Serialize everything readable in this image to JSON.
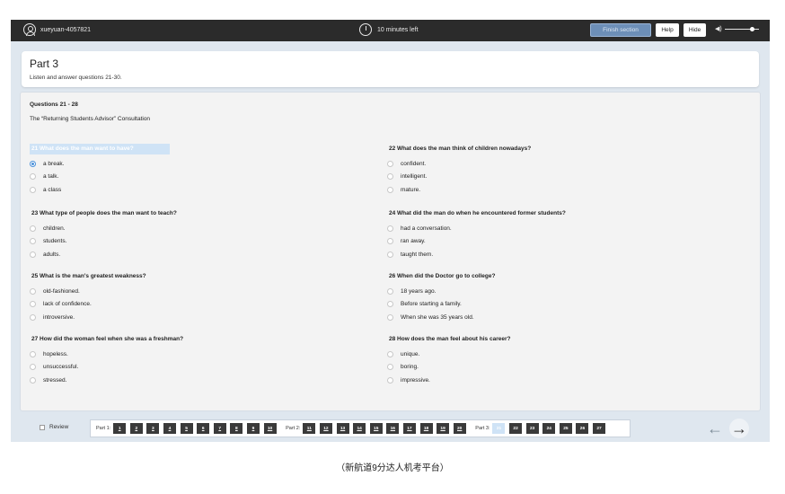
{
  "topbar": {
    "username": "xueyuan-4057821",
    "timer": "10 minutes left",
    "finish_label": "Finish section",
    "help_label": "Help",
    "hide_label": "Hide"
  },
  "part": {
    "title": "Part 3",
    "instruction": "Listen and answer questions 21-30."
  },
  "section": {
    "range": "Questions 21 - 28",
    "topic": "The “Returning Students Advisor” Consultation"
  },
  "questions": {
    "q21": {
      "text": "21 What does the man want to have?",
      "options": [
        "a break.",
        "a talk.",
        "a class"
      ]
    },
    "q22": {
      "text": "22 What does the man think of children nowadays?",
      "options": [
        "confident.",
        "intelligent.",
        "mature."
      ]
    },
    "q23": {
      "text": "23 What type of people does the man want to teach?",
      "options": [
        "children.",
        "students.",
        "adults."
      ]
    },
    "q24": {
      "text": "24 What did the man do when he encountered former students?",
      "options": [
        "had a conversation.",
        "ran away.",
        "taught them."
      ]
    },
    "q25": {
      "text": "25 What is the man's greatest weakness?",
      "options": [
        "old-fashioned.",
        "lack of confidence.",
        "introversive."
      ]
    },
    "q26": {
      "text": "26 When did the Doctor go to college?",
      "options": [
        "18 years ago.",
        "Before starting a family.",
        "When she was 35 years old."
      ]
    },
    "q27": {
      "text": "27 How did the woman feel when she was a freshman?",
      "options": [
        "hopeless.",
        "unsuccessful.",
        "stressed."
      ]
    },
    "q28": {
      "text": "28 How does the man feel about his career?",
      "options": [
        "unique.",
        "boring.",
        "impressive."
      ]
    }
  },
  "nav": {
    "review_label": "Review",
    "part1_label": "Part 1:",
    "part2_label": "Part 2:",
    "part3_label": "Part 3:",
    "part1": [
      "1",
      "2",
      "3",
      "4",
      "5",
      "6",
      "7",
      "8",
      "9",
      "10"
    ],
    "part2": [
      "11",
      "12",
      "13",
      "14",
      "15",
      "16",
      "17",
      "18",
      "19",
      "20"
    ],
    "part3": [
      "21",
      "22",
      "23",
      "24",
      "25",
      "26",
      "27"
    ],
    "prev_icon": "←",
    "next_icon": "→"
  },
  "caption": "（新航道9分达人机考平台）"
}
